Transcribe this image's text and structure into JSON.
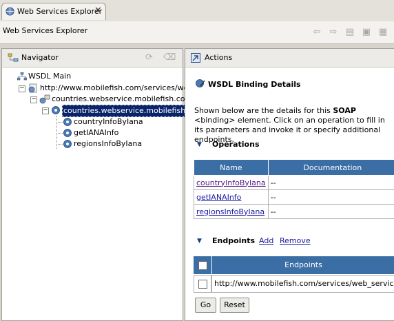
{
  "tab": {
    "label": "Web Services Explorer",
    "close": "✕"
  },
  "window": {
    "title": "Web Services Explorer"
  },
  "navigator": {
    "title": "Navigator",
    "tree": {
      "root": "WSDL Main",
      "wsdl_url": "http://www.mobilefish.com/services/web_",
      "service": "countries.webservice.mobilefish.comSe",
      "binding": "countries.webservice.mobilefish.co",
      "operations": [
        "countryInfoByIana",
        "getIANAInfo",
        "regionsInfoByIana"
      ]
    }
  },
  "actions": {
    "title": "Actions",
    "section_title": "WSDL Binding Details",
    "description_pre": "Shown below are the details for this ",
    "description_bold": "SOAP",
    "description_post": " <binding> element. Click on an operation to fill in its parameters and invoke it or specify additional endpoints.",
    "operations_heading": "Operations",
    "table_headers": [
      "Name",
      "Documentation"
    ],
    "operations": [
      {
        "name": "countryInfoByIana",
        "doc": "--"
      },
      {
        "name": "getIANAInfo",
        "doc": "--"
      },
      {
        "name": "regionsInfoByIana",
        "doc": "--"
      }
    ],
    "endpoints_heading": "Endpoints",
    "add_label": "Add",
    "remove_label": "Remove",
    "endpoints_header": "Endpoints",
    "endpoint_url": "http://www.mobilefish.com/services/web_service/coun",
    "go_label": "Go",
    "reset_label": "Reset"
  },
  "colors": {
    "selection": "#0a246a",
    "table_header": "#3a6ea5",
    "link": "#551a8b"
  }
}
